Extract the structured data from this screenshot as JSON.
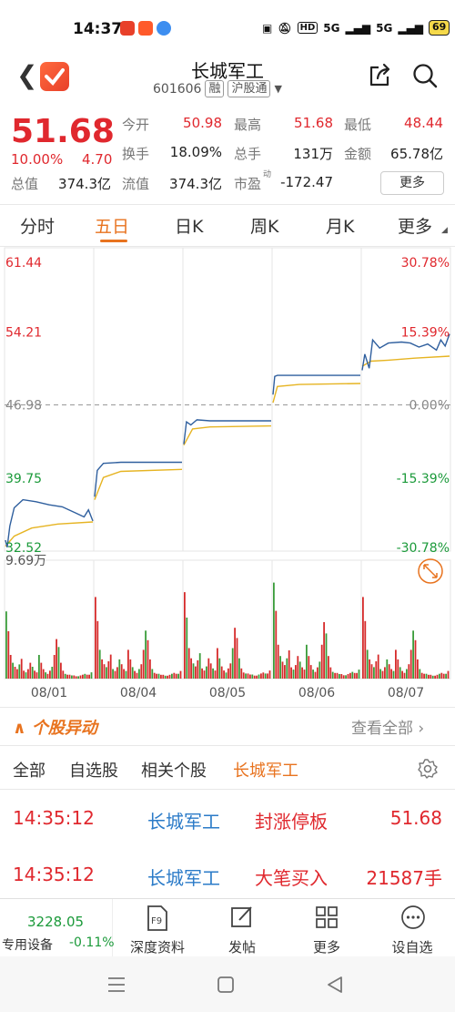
{
  "status_bar": {
    "time": "14:37",
    "network_labels": [
      "HD",
      "5G",
      "5G"
    ],
    "battery": "69"
  },
  "header": {
    "title": "长城军工",
    "code": "601606",
    "badge_rong": "融",
    "badge_hgt": "沪股通",
    "icons": [
      "back-arrow-icon",
      "app-logo-icon",
      "share-icon",
      "search-icon"
    ]
  },
  "quote": {
    "price": "51.68",
    "change_pct": "10.00%",
    "change": "4.70",
    "stats": [
      {
        "label": "今开",
        "value": "50.98",
        "red": true
      },
      {
        "label": "最高",
        "value": "51.68",
        "red": true
      },
      {
        "label": "最低",
        "value": "48.44",
        "red": true
      },
      {
        "label": "换手",
        "value": "18.09%",
        "red": false
      },
      {
        "label": "总手",
        "value": "131万",
        "red": false
      },
      {
        "label": "金额",
        "value": "65.78亿",
        "red": false
      },
      {
        "label": "总值",
        "value": "374.3亿",
        "red": false
      },
      {
        "label": "流值",
        "value": "374.3亿",
        "red": false
      },
      {
        "label": "市盈",
        "value": "-172.47",
        "red": false
      }
    ],
    "pe_superscript": "动",
    "more_button": "更多"
  },
  "tabs": [
    "分时",
    "五日",
    "日K",
    "周K",
    "月K",
    "更多"
  ],
  "active_tab": "五日",
  "chart_data": {
    "type": "line",
    "title": "",
    "x_labels": [
      "08/01",
      "08/04",
      "08/05",
      "08/06",
      "08/07"
    ],
    "y_left_labels": [
      "61.44",
      "54.21",
      "46.98",
      "39.75",
      "32.52"
    ],
    "y_right_labels": [
      "30.78%",
      "15.39%",
      "0.00%",
      "-15.39%",
      "-30.78%"
    ],
    "ylim": [
      32.52,
      61.44
    ],
    "reference_price": 46.98,
    "volume_max_label": "9.69万",
    "series": [],
    "days": [
      {
        "date": "08/01",
        "price": [
          [
            0,
            33.6
          ],
          [
            0.02,
            32.9
          ],
          [
            0.05,
            35.0
          ],
          [
            0.1,
            36.8
          ],
          [
            0.2,
            37.6
          ],
          [
            0.35,
            37.4
          ],
          [
            0.5,
            37.1
          ],
          [
            0.65,
            36.9
          ],
          [
            0.8,
            36.3
          ],
          [
            0.9,
            35.9
          ],
          [
            0.95,
            36.6
          ],
          [
            1.0,
            35.5
          ]
        ],
        "avg": [
          [
            0,
            33.0
          ],
          [
            0.1,
            34.0
          ],
          [
            0.3,
            34.8
          ],
          [
            0.6,
            35.2
          ],
          [
            1.0,
            35.4
          ]
        ]
      },
      {
        "date": "08/04",
        "price": [
          [
            0,
            37.9
          ],
          [
            0.03,
            40.5
          ],
          [
            0.1,
            41.2
          ],
          [
            0.3,
            41.3
          ],
          [
            1.0,
            41.3
          ]
        ],
        "avg": [
          [
            0,
            37.6
          ],
          [
            0.1,
            39.8
          ],
          [
            0.3,
            40.4
          ],
          [
            1.0,
            40.6
          ]
        ]
      },
      {
        "date": "08/05",
        "price": [
          [
            0,
            43.1
          ],
          [
            0.03,
            45.3
          ],
          [
            0.08,
            45.0
          ],
          [
            0.15,
            45.5
          ],
          [
            0.3,
            45.4
          ],
          [
            1.0,
            45.4
          ]
        ],
        "avg": [
          [
            0,
            43.0
          ],
          [
            0.1,
            44.6
          ],
          [
            0.3,
            44.8
          ],
          [
            1.0,
            44.9
          ]
        ]
      },
      {
        "date": "08/06",
        "price": [
          [
            0,
            48.0
          ],
          [
            0.02,
            49.8
          ],
          [
            0.05,
            49.9
          ],
          [
            1.0,
            49.9
          ]
        ],
        "avg": [
          [
            0,
            47.2
          ],
          [
            0.05,
            48.8
          ],
          [
            0.3,
            49.0
          ],
          [
            1.0,
            49.1
          ]
        ]
      },
      {
        "date": "08/07",
        "price": [
          [
            0,
            50.4
          ],
          [
            0.03,
            52.0
          ],
          [
            0.08,
            50.6
          ],
          [
            0.12,
            53.4
          ],
          [
            0.2,
            52.6
          ],
          [
            0.3,
            53.1
          ],
          [
            0.45,
            53.2
          ],
          [
            0.55,
            53.1
          ],
          [
            0.65,
            52.7
          ],
          [
            0.75,
            53.0
          ],
          [
            0.85,
            52.4
          ],
          [
            0.9,
            53.4
          ],
          [
            0.95,
            52.8
          ],
          [
            1.0,
            54.0
          ]
        ],
        "avg": [
          [
            0,
            50.8
          ],
          [
            0.1,
            51.3
          ],
          [
            0.3,
            51.4
          ],
          [
            0.6,
            51.6
          ],
          [
            1.0,
            51.8
          ]
        ]
      }
    ],
    "volume_profile": [
      0.85,
      0.6,
      0.3,
      0.2,
      0.15,
      0.12,
      0.18,
      0.25,
      0.1,
      0.08,
      0.12,
      0.2,
      0.15,
      0.1,
      0.08,
      0.3,
      0.2,
      0.12,
      0.08,
      0.06,
      0.1,
      0.15,
      0.3,
      0.5,
      0.4,
      0.2,
      0.1,
      0.06,
      0.05,
      0.05,
      0.04,
      0.04,
      0.03,
      0.03,
      0.04,
      0.05,
      0.06,
      0.05,
      0.05,
      0.08
    ],
    "day_volume_scale": [
      0.7,
      0.85,
      0.9,
      1.0,
      0.85
    ],
    "colors": {
      "price": "#2f5f9e",
      "avg": "#e6b422",
      "up": "#d62b2b",
      "down": "#3a9c3a",
      "axis_red": "#e0282e",
      "axis_green": "#1b9a3a"
    }
  },
  "anomaly": {
    "title": "个股异动",
    "view_all": "查看全部",
    "filters": [
      "全部",
      "自选股",
      "相关个股",
      "长城军工"
    ],
    "active_filter": "长城军工",
    "rows": [
      {
        "time": "14:35:12",
        "name": "长城军工",
        "event": "封涨停板",
        "value": "51.68"
      },
      {
        "time": "14:35:12",
        "name": "长城军工",
        "event": "大笔买入",
        "value": "21587手"
      }
    ]
  },
  "toolbar": {
    "index_value": "3228.05",
    "index_label": "专用设备",
    "index_pct": "-0.11%",
    "items": [
      {
        "label": "深度资料",
        "icon": "f9-icon"
      },
      {
        "label": "发帖",
        "icon": "edit-icon"
      },
      {
        "label": "更多",
        "icon": "grid-icon"
      },
      {
        "label": "设自选",
        "icon": "more-dots-icon"
      }
    ]
  }
}
